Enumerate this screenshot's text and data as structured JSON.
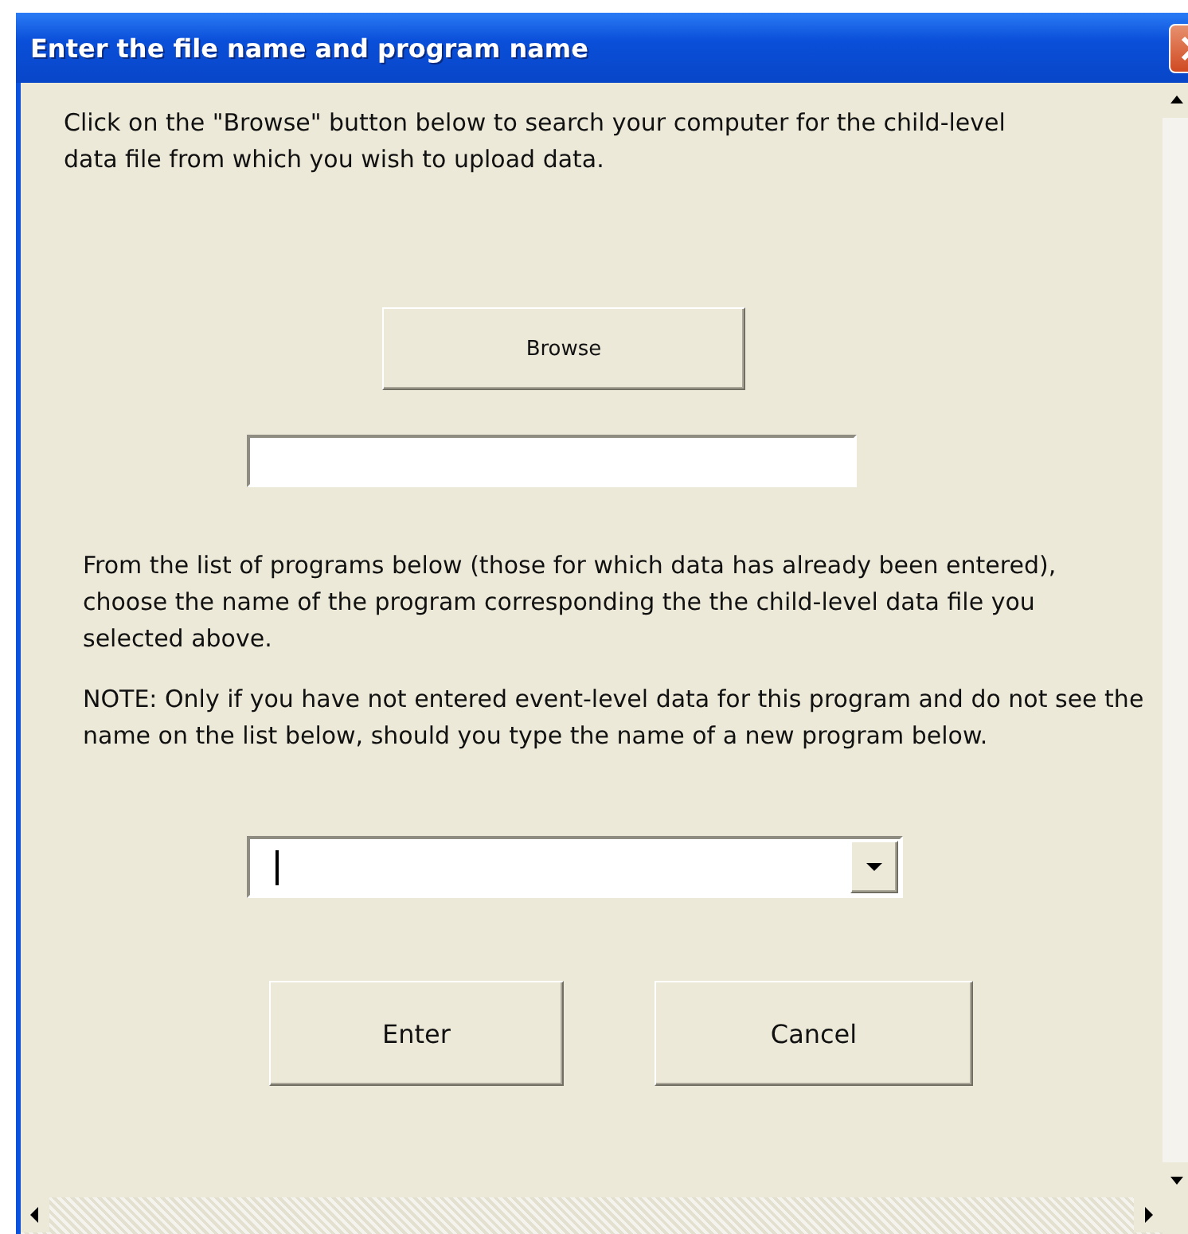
{
  "window": {
    "title": "Enter the file name and program name"
  },
  "intro": "Click on the \"Browse\" button below to search your computer for the child-level data file from which you wish to upload data.",
  "browse_button": "Browse",
  "instructions": "From the list of programs below (those for which data has already been entered), choose the name of the program corresponding the the child-level data file you selected above.",
  "note": "NOTE: Only if you have not entered event-level data for this program and do not see the name on the list below, should you type the name of a new program below.",
  "program_combo": {
    "focused": true
  },
  "buttons": [
    "Enter",
    "Cancel"
  ]
}
